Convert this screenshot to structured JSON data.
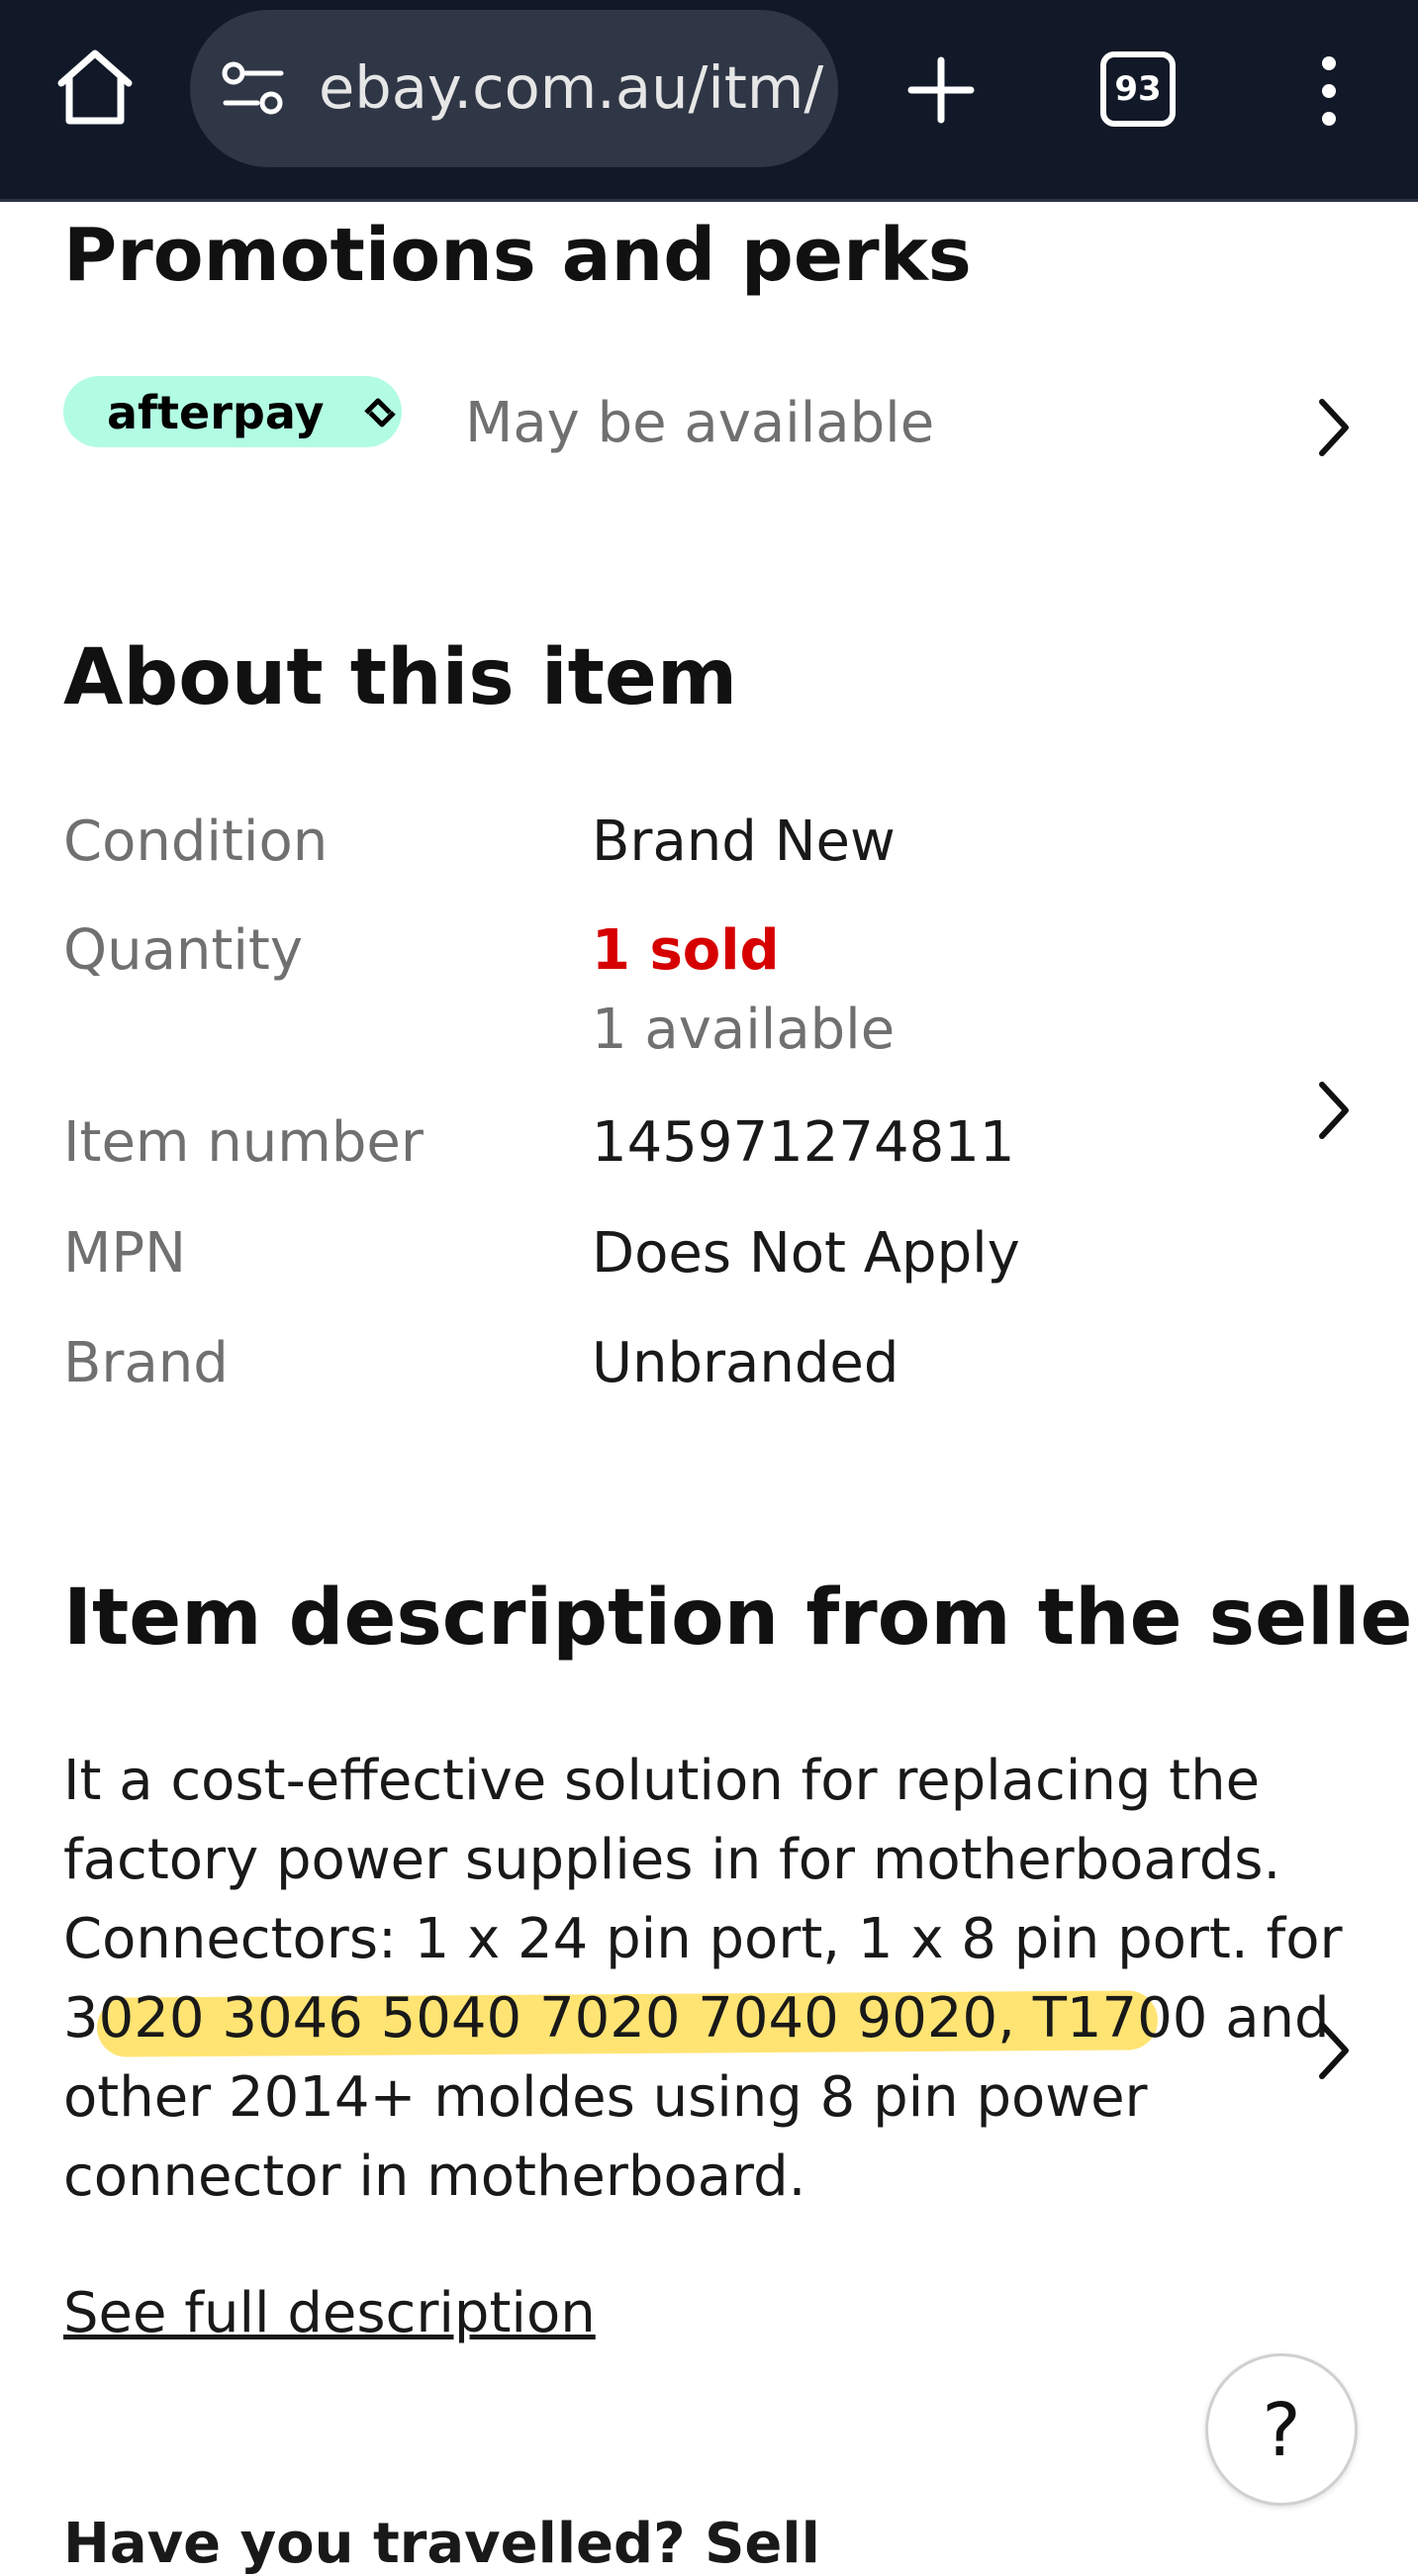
{
  "browser": {
    "url": "ebay.com.au/itm/",
    "tab_count": "93"
  },
  "promotions": {
    "title": "Promotions and perks",
    "afterpay_label": "afterpay",
    "availability": "May be available"
  },
  "about": {
    "title": "About this item",
    "rows": [
      {
        "label": "Condition",
        "value": "Brand New"
      },
      {
        "label": "Quantity",
        "value": "1 sold",
        "sub": "1 available"
      },
      {
        "label": "Item number",
        "value": "145971274811"
      },
      {
        "label": "MPN",
        "value": "Does Not Apply"
      },
      {
        "label": "Brand",
        "value": "Unbranded"
      }
    ]
  },
  "description": {
    "title": "Item description from the seller",
    "lines": [
      "It a cost-effective solution for replacing the",
      "factory power supplies in for motherboards.",
      "Connectors: 1 x 24 pin port, 1 x 8 pin port. for",
      "3020 3046 5040 7020 7040 9020, T1700 and",
      "other 2014+ moldes using 8 pin power",
      "connector in motherboard."
    ],
    "see_full": "See full description"
  },
  "help": {
    "label": "?"
  },
  "bottom_peek": "Have you travelled? Sell"
}
